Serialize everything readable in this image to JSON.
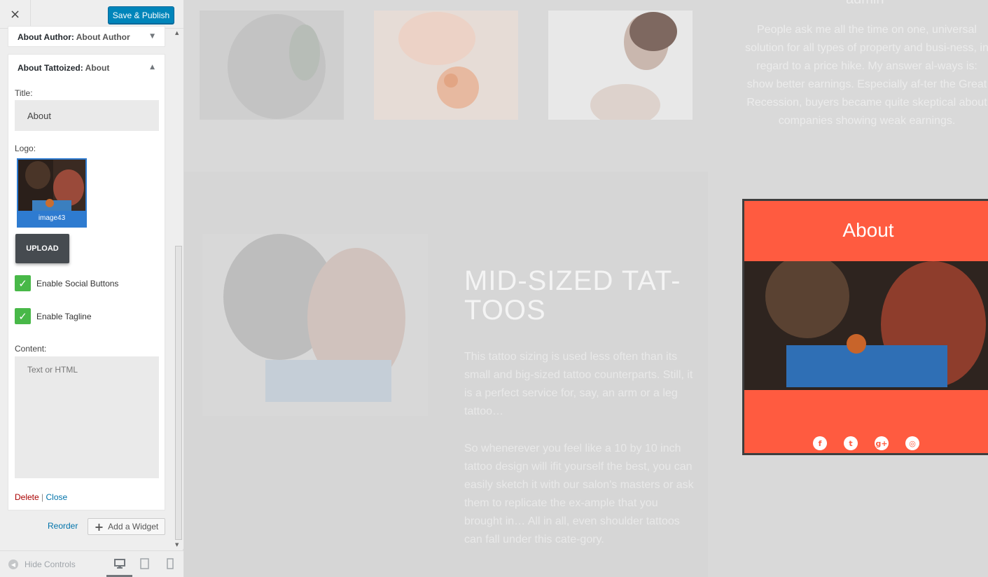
{
  "topbar": {
    "close_icon": "×",
    "save_label": "Save & Publish"
  },
  "widgets": {
    "collapsed": {
      "name": "About Author",
      "title": "About Author",
      "arrow": "▼"
    },
    "open": {
      "name": "About Tattoized",
      "title": "About",
      "arrow": "▲"
    }
  },
  "form": {
    "title_label": "Title:",
    "title_value": "About",
    "logo_label": "Logo:",
    "logo_caption": "image43",
    "upload_label": "UPLOAD",
    "social_label": "Enable Social Buttons",
    "tagline_label": "Enable Tagline",
    "check_mark": "✓",
    "content_label": "Content:",
    "content_placeholder": "Text or HTML",
    "delete_label": "Delete",
    "separator": "|",
    "close_label": "Close"
  },
  "panel_actions": {
    "reorder_label": "Reorder",
    "add_widget_label": "Add a Widget",
    "plus": "+"
  },
  "footer": {
    "hide_controls_label": "Hide Controls",
    "hide_icon": "◀"
  },
  "preview": {
    "author_heading": "admin",
    "author_text": "People ask me all the time on one, universal solution for all types of property and busi-ness, in regard to a price hike. My answer al-ways is: show better earnings. Especially af-ter the Great Recession, buyers became quite skeptical about companies showing weak earnings.",
    "headline": "MID-SIZED TAT-TOOS",
    "para1": "This tattoo sizing is used less often than its small and big-sized tattoo counterparts. Still, it is a perfect service for, say, an arm or a leg tattoo…",
    "para2": "So whenerever you feel like a 10 by 10 inch tattoo design will ifit yourself the best, you can easily sketch it with our salon's masters or ask them to replicate the ex-ample that you brought in… All in all, even shoulder tattoos can fall under this cate-gory.",
    "about_title": "About",
    "social_icons": [
      "f",
      "t",
      "g+",
      "◎"
    ]
  },
  "colors": {
    "accent": "#ff5b40",
    "save": "#0085ba",
    "checkbox": "#48b848",
    "link": "#0073aa",
    "delete": "#aa0000"
  }
}
